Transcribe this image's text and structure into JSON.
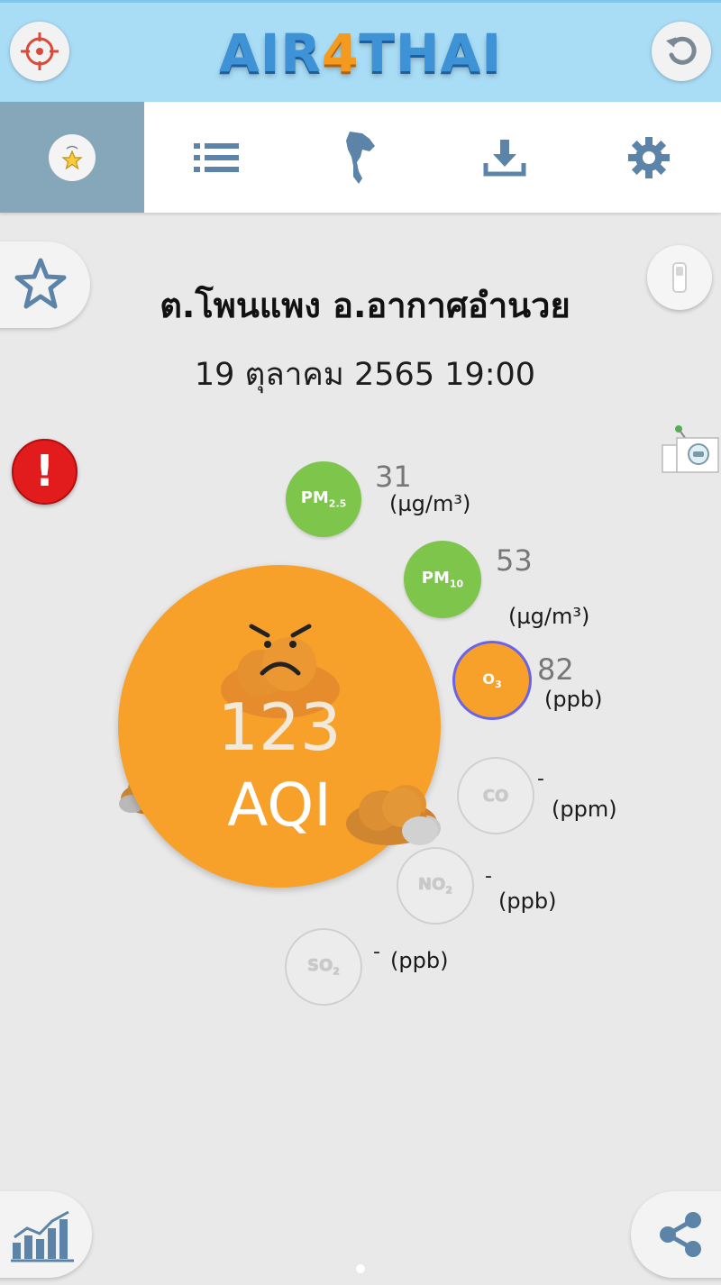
{
  "app": {
    "title_prefix": "AIR",
    "title_four": "4",
    "title_suffix": "THAI"
  },
  "top_buttons": {
    "left_icon": "locate-icon",
    "right_icon": "refresh-icon"
  },
  "tabs": [
    {
      "id": "favorites",
      "icon": "favorite-icon",
      "active": true
    },
    {
      "id": "list",
      "icon": "list-icon",
      "active": false
    },
    {
      "id": "map",
      "icon": "thailand-map-icon",
      "active": false
    },
    {
      "id": "download",
      "icon": "download-icon",
      "active": false
    },
    {
      "id": "settings",
      "icon": "gear-icon",
      "active": false
    }
  ],
  "station": {
    "name": "ต.โพนแพง อ.อากาศอำนวย",
    "datetime": "19 ตุลาคม 2565 19:00"
  },
  "aqi": {
    "value": "123",
    "label": "AQI",
    "color": "#f7a12b",
    "level": "unhealthy-sensitive"
  },
  "pollutants": {
    "pm25": {
      "label_main": "PM",
      "label_sub": "2.5",
      "value": "31",
      "unit": "(µg/m³)",
      "color": "#7ec54c"
    },
    "pm10": {
      "label_main": "PM",
      "label_sub": "10",
      "value": "53",
      "unit": "(µg/m³)",
      "color": "#7ec54c"
    },
    "o3": {
      "label_main": "O",
      "label_sub": "3",
      "value": "82",
      "unit": "(ppb)",
      "color": "#f7a12b"
    },
    "co": {
      "label_main": "CO",
      "label_sub": "",
      "value": "-",
      "unit": "(ppm)",
      "color": "#ececec"
    },
    "no2": {
      "label_main": "NO",
      "label_sub": "2",
      "value": "-",
      "unit": "(ppb)",
      "color": "#ececec"
    },
    "so2": {
      "label_main": "SO",
      "label_sub": "2",
      "value": "-",
      "unit": "(ppb)",
      "color": "#ececec"
    }
  },
  "colors": {
    "topbar": "#a9dcf5",
    "active_tab": "#86a7b9",
    "alert": "#e21c1c"
  }
}
